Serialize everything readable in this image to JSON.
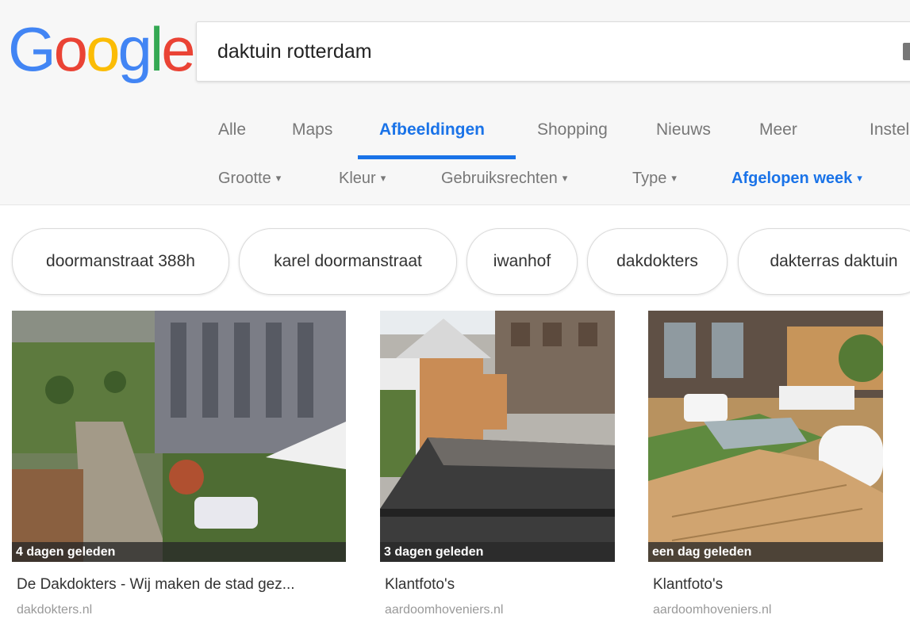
{
  "logo": {
    "letters": [
      "G",
      "o",
      "o",
      "g",
      "l",
      "e"
    ],
    "colors": [
      "#4285F4",
      "#EA4335",
      "#FBBC05",
      "#4285F4",
      "#34A853",
      "#EA4335"
    ]
  },
  "search": {
    "query": "daktuin rotterdam"
  },
  "tabs": [
    {
      "label": "Alle"
    },
    {
      "label": "Maps"
    },
    {
      "label": "Afbeeldingen",
      "active": true
    },
    {
      "label": "Shopping"
    },
    {
      "label": "Nieuws"
    },
    {
      "label": "Meer"
    },
    {
      "label": "Instel"
    }
  ],
  "filters": [
    {
      "label": "Grootte"
    },
    {
      "label": "Kleur"
    },
    {
      "label": "Gebruiksrechten"
    },
    {
      "label": "Type"
    },
    {
      "label": "Afgelopen week",
      "active": true
    }
  ],
  "chips": [
    "doormanstraat 388h",
    "karel doormanstraat",
    "iwanhof",
    "dakdokters",
    "dakterras daktuin"
  ],
  "results": [
    {
      "age": "4 dagen geleden",
      "title": "De Dakdokters - Wij maken de stad gez...",
      "domain": "dakdokters.nl"
    },
    {
      "age": "3 dagen geleden",
      "title": "Klantfoto's",
      "domain": "aardoomhoveniers.nl"
    },
    {
      "age": "een dag geleden",
      "title": "Klantfoto's",
      "domain": "aardoomhoveniers.nl"
    }
  ],
  "colors": {
    "accent": "#1a73e8",
    "muted": "#777777",
    "header_bg": "#f7f7f7"
  },
  "icons": {
    "caret": "▾",
    "keyboard": "keyboard-icon"
  }
}
